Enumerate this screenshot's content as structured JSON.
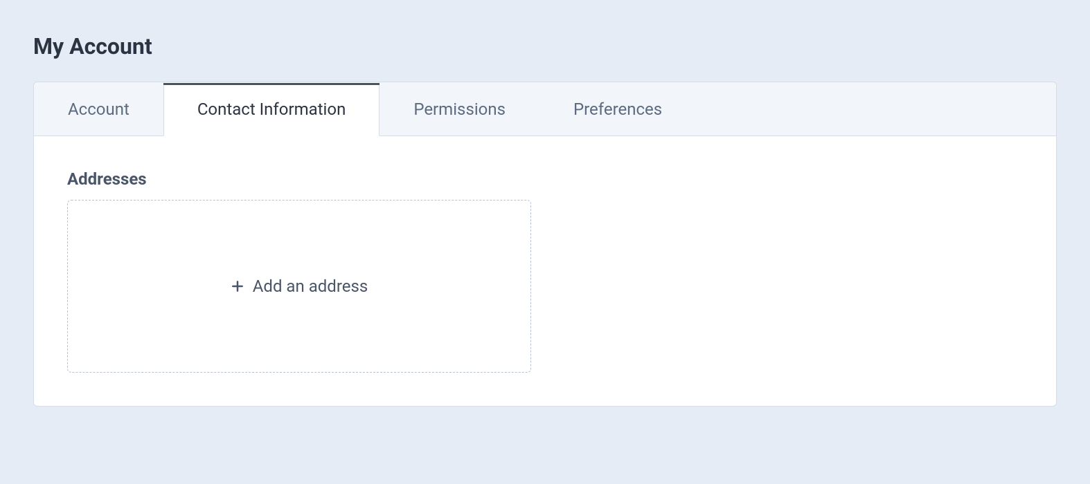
{
  "page": {
    "title": "My Account"
  },
  "tabs": [
    {
      "label": "Account",
      "active": false
    },
    {
      "label": "Contact Information",
      "active": true
    },
    {
      "label": "Permissions",
      "active": false
    },
    {
      "label": "Preferences",
      "active": false
    }
  ],
  "content": {
    "addresses": {
      "heading": "Addresses",
      "add_label": "Add an address"
    }
  }
}
